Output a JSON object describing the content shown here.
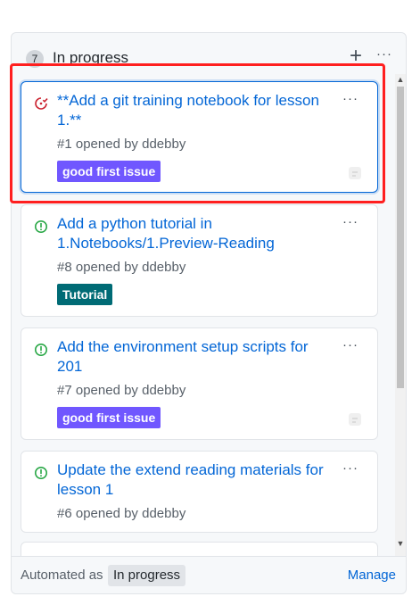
{
  "column": {
    "count": "7",
    "title": "In progress",
    "add_icon": "plus-icon",
    "more_icon": "kebab-horizontal-icon"
  },
  "cards": [
    {
      "title": "**Add a git training notebook for lesson 1.**",
      "number": "#1",
      "opened_by_text": "opened by",
      "author": "ddebby",
      "label": "good first issue",
      "label_color": "#7057ff",
      "state_icon": "issue-closed-icon",
      "state_color": "#cb2431",
      "more_label": "···"
    },
    {
      "title": "Add a python tutorial in 1.Notebooks/1.Preview-Reading",
      "number": "#8",
      "opened_by_text": "opened by",
      "author": "ddebby",
      "label": "Tutorial",
      "label_color": "#006b75",
      "state_icon": "issue-opened-icon",
      "state_color": "#28a745",
      "more_label": "···"
    },
    {
      "title": "Add the environment setup scripts for 201",
      "number": "#7",
      "opened_by_text": "opened by",
      "author": "ddebby",
      "label": "good first issue",
      "label_color": "#7057ff",
      "state_icon": "issue-opened-icon",
      "state_color": "#28a745",
      "more_label": "···"
    },
    {
      "title": "Update the extend reading materials for lesson 1",
      "number": "#6",
      "opened_by_text": "opened by",
      "author": "ddebby",
      "state_icon": "issue-opened-icon",
      "state_color": "#28a745",
      "more_label": "···"
    }
  ],
  "footer": {
    "automated_text": "Automated as",
    "automation_value": "In progress",
    "manage_label": "Manage"
  },
  "header_more_label": "···",
  "colors": {
    "link": "#0366d6",
    "highlight": "#ff1f1f"
  }
}
